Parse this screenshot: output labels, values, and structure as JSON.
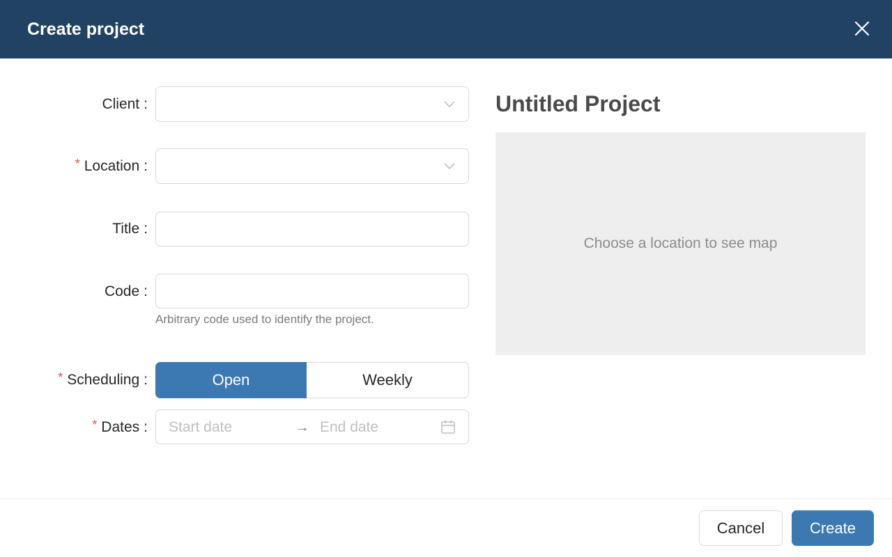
{
  "dialog": {
    "title": "Create project"
  },
  "form": {
    "client": {
      "label": "Client",
      "value": ""
    },
    "location": {
      "label": "Location",
      "value": ""
    },
    "title": {
      "label": "Title",
      "value": ""
    },
    "code": {
      "label": "Code",
      "value": "",
      "help": "Arbitrary code used to identify the project."
    },
    "scheduling": {
      "label": "Scheduling",
      "options": [
        "Open",
        "Weekly"
      ],
      "selected": "Open"
    },
    "dates": {
      "label": "Dates",
      "start_placeholder": "Start date",
      "arrow": "→",
      "end_placeholder": "End date"
    },
    "required_mark": "*",
    "colon": ":"
  },
  "preview": {
    "project_title": "Untitled Project",
    "map_placeholder": "Choose a location to see map"
  },
  "footer": {
    "cancel_label": "Cancel",
    "create_label": "Create"
  },
  "colors": {
    "header_bg": "#224264",
    "primary": "#3c79b3",
    "required": "#e24a4a",
    "map_bg": "#eeeeee"
  },
  "icons": {
    "close": "close-icon",
    "chevron": "chevron-down-icon",
    "calendar": "calendar-icon"
  }
}
